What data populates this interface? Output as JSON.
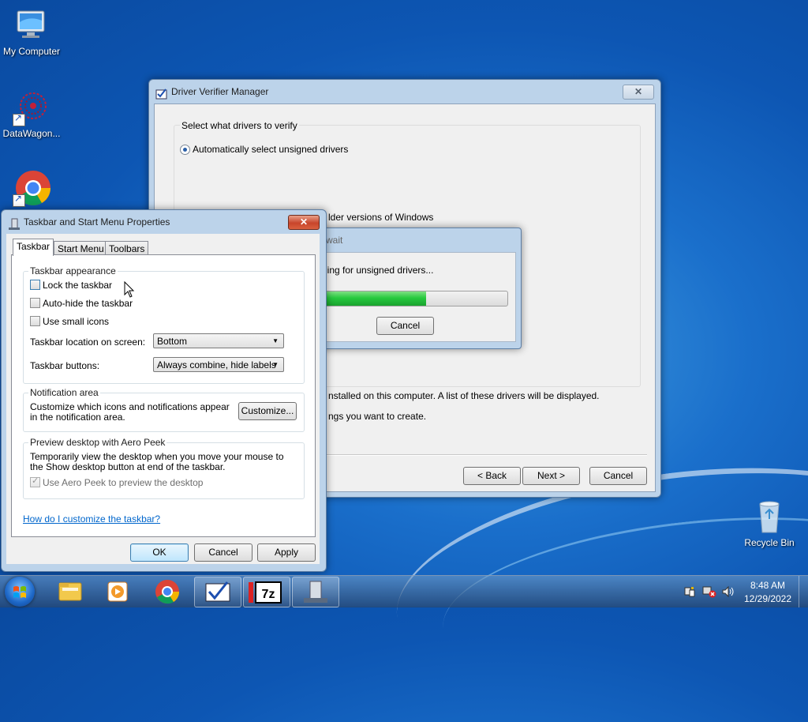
{
  "desktop": {
    "icons": [
      {
        "label": "My Computer"
      },
      {
        "label": "DataWagon..."
      },
      {
        "label": ""
      },
      {
        "label": "Recycle Bin"
      }
    ]
  },
  "verifier": {
    "title": "Driver Verifier Manager",
    "group_label": "Select what drivers to verify",
    "option_auto": "Automatically select unsigned drivers",
    "option_older_fragment": "lder versions of Windows",
    "installed_fragment": "nstalled on this computer. A list of these drivers will be displayed.",
    "settings_fragment": "ngs you want to create.",
    "back": "< Back",
    "next": "Next >",
    "cancel": "Cancel"
  },
  "wait_dialog": {
    "title_fragment": "wait",
    "message_fragment": "ning for unsigned drivers...",
    "progress": 0.56,
    "cancel": "Cancel"
  },
  "taskbar_props": {
    "title": "Taskbar and Start Menu Properties",
    "tabs": [
      {
        "label": "Taskbar"
      },
      {
        "label": "Start Menu"
      },
      {
        "label": "Toolbars"
      }
    ],
    "appearance": {
      "title": "Taskbar appearance",
      "lock": "Lock the taskbar",
      "autohide": "Auto-hide the taskbar",
      "small_icons": "Use small icons",
      "location_label": "Taskbar location on screen:",
      "location_value": "Bottom",
      "buttons_label": "Taskbar buttons:",
      "buttons_value": "Always combine, hide labels"
    },
    "notification": {
      "title": "Notification area",
      "text": "Customize which icons and notifications appear in the notification area.",
      "customize": "Customize..."
    },
    "peek": {
      "title": "Preview desktop with Aero Peek",
      "text": "Temporarily view the desktop when you move your mouse to the Show desktop button at end of the taskbar.",
      "checkbox": "Use Aero Peek to preview the desktop"
    },
    "help_link": "How do I customize the taskbar?",
    "ok": "OK",
    "cancel": "Cancel",
    "apply": "Apply"
  },
  "clock": {
    "time": "8:48 AM",
    "date": "12/29/2022"
  },
  "colors": {
    "progress_green": "#27c93f",
    "link_blue": "#0066cc"
  }
}
